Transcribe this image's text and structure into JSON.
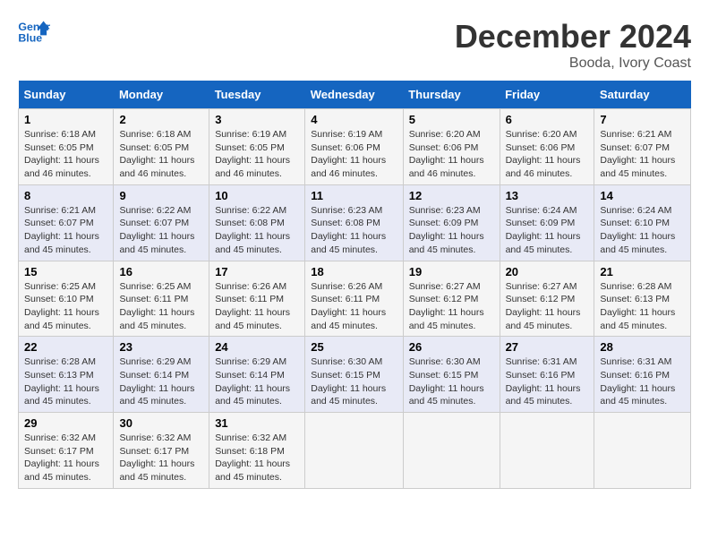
{
  "header": {
    "logo_line1": "General",
    "logo_line2": "Blue",
    "month_title": "December 2024",
    "location": "Booda, Ivory Coast"
  },
  "days_of_week": [
    "Sunday",
    "Monday",
    "Tuesday",
    "Wednesday",
    "Thursday",
    "Friday",
    "Saturday"
  ],
  "weeks": [
    [
      {
        "day": "1",
        "sunrise": "6:18 AM",
        "sunset": "6:05 PM",
        "daylight": "11 hours and 46 minutes."
      },
      {
        "day": "2",
        "sunrise": "6:18 AM",
        "sunset": "6:05 PM",
        "daylight": "11 hours and 46 minutes."
      },
      {
        "day": "3",
        "sunrise": "6:19 AM",
        "sunset": "6:05 PM",
        "daylight": "11 hours and 46 minutes."
      },
      {
        "day": "4",
        "sunrise": "6:19 AM",
        "sunset": "6:06 PM",
        "daylight": "11 hours and 46 minutes."
      },
      {
        "day": "5",
        "sunrise": "6:20 AM",
        "sunset": "6:06 PM",
        "daylight": "11 hours and 46 minutes."
      },
      {
        "day": "6",
        "sunrise": "6:20 AM",
        "sunset": "6:06 PM",
        "daylight": "11 hours and 46 minutes."
      },
      {
        "day": "7",
        "sunrise": "6:21 AM",
        "sunset": "6:07 PM",
        "daylight": "11 hours and 45 minutes."
      }
    ],
    [
      {
        "day": "8",
        "sunrise": "6:21 AM",
        "sunset": "6:07 PM",
        "daylight": "11 hours and 45 minutes."
      },
      {
        "day": "9",
        "sunrise": "6:22 AM",
        "sunset": "6:07 PM",
        "daylight": "11 hours and 45 minutes."
      },
      {
        "day": "10",
        "sunrise": "6:22 AM",
        "sunset": "6:08 PM",
        "daylight": "11 hours and 45 minutes."
      },
      {
        "day": "11",
        "sunrise": "6:23 AM",
        "sunset": "6:08 PM",
        "daylight": "11 hours and 45 minutes."
      },
      {
        "day": "12",
        "sunrise": "6:23 AM",
        "sunset": "6:09 PM",
        "daylight": "11 hours and 45 minutes."
      },
      {
        "day": "13",
        "sunrise": "6:24 AM",
        "sunset": "6:09 PM",
        "daylight": "11 hours and 45 minutes."
      },
      {
        "day": "14",
        "sunrise": "6:24 AM",
        "sunset": "6:10 PM",
        "daylight": "11 hours and 45 minutes."
      }
    ],
    [
      {
        "day": "15",
        "sunrise": "6:25 AM",
        "sunset": "6:10 PM",
        "daylight": "11 hours and 45 minutes."
      },
      {
        "day": "16",
        "sunrise": "6:25 AM",
        "sunset": "6:11 PM",
        "daylight": "11 hours and 45 minutes."
      },
      {
        "day": "17",
        "sunrise": "6:26 AM",
        "sunset": "6:11 PM",
        "daylight": "11 hours and 45 minutes."
      },
      {
        "day": "18",
        "sunrise": "6:26 AM",
        "sunset": "6:11 PM",
        "daylight": "11 hours and 45 minutes."
      },
      {
        "day": "19",
        "sunrise": "6:27 AM",
        "sunset": "6:12 PM",
        "daylight": "11 hours and 45 minutes."
      },
      {
        "day": "20",
        "sunrise": "6:27 AM",
        "sunset": "6:12 PM",
        "daylight": "11 hours and 45 minutes."
      },
      {
        "day": "21",
        "sunrise": "6:28 AM",
        "sunset": "6:13 PM",
        "daylight": "11 hours and 45 minutes."
      }
    ],
    [
      {
        "day": "22",
        "sunrise": "6:28 AM",
        "sunset": "6:13 PM",
        "daylight": "11 hours and 45 minutes."
      },
      {
        "day": "23",
        "sunrise": "6:29 AM",
        "sunset": "6:14 PM",
        "daylight": "11 hours and 45 minutes."
      },
      {
        "day": "24",
        "sunrise": "6:29 AM",
        "sunset": "6:14 PM",
        "daylight": "11 hours and 45 minutes."
      },
      {
        "day": "25",
        "sunrise": "6:30 AM",
        "sunset": "6:15 PM",
        "daylight": "11 hours and 45 minutes."
      },
      {
        "day": "26",
        "sunrise": "6:30 AM",
        "sunset": "6:15 PM",
        "daylight": "11 hours and 45 minutes."
      },
      {
        "day": "27",
        "sunrise": "6:31 AM",
        "sunset": "6:16 PM",
        "daylight": "11 hours and 45 minutes."
      },
      {
        "day": "28",
        "sunrise": "6:31 AM",
        "sunset": "6:16 PM",
        "daylight": "11 hours and 45 minutes."
      }
    ],
    [
      {
        "day": "29",
        "sunrise": "6:32 AM",
        "sunset": "6:17 PM",
        "daylight": "11 hours and 45 minutes."
      },
      {
        "day": "30",
        "sunrise": "6:32 AM",
        "sunset": "6:17 PM",
        "daylight": "11 hours and 45 minutes."
      },
      {
        "day": "31",
        "sunrise": "6:32 AM",
        "sunset": "6:18 PM",
        "daylight": "11 hours and 45 minutes."
      },
      null,
      null,
      null,
      null
    ]
  ]
}
